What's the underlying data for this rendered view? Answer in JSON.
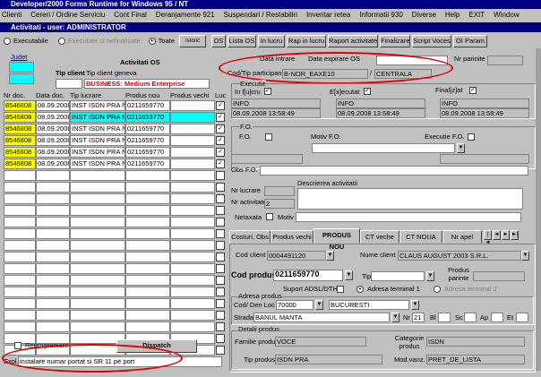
{
  "window": {
    "title": "Developer/2000 Forms Runtime for Windows 95 / NT"
  },
  "menu": [
    "Clienti",
    "Cereri / Ordine Serviciu",
    "Cont Final",
    "Deranjamente 921",
    "Suspendari / Restabiliri",
    "Inventar retea",
    "Informatii 930",
    "Diverse",
    "Help",
    "EXIT",
    "Window"
  ],
  "form_title": "Activitati - user: ADMINISTRATOR",
  "filters": {
    "executabile": "Executabile",
    "executate": "Executate si nefinalizate",
    "toate": "Toate"
  },
  "toolbar": [
    "Istoric",
    "OS",
    "Lista OS",
    "In lucru",
    "Rap in lucru",
    "Raport activitate",
    "Finalizare",
    "Script Voces",
    "OI Param"
  ],
  "judet_label": "Judet",
  "activitati_os": "Activitati OS",
  "tip_client_label": "Tip client",
  "tip_client_value": "Tip client geneva",
  "business": "BUSINESS: Medium Enterprise",
  "data_intrare_label": "Data intrare",
  "data_expirare_label": "Data expirare OS",
  "nr_pariuri_label": "Nr parinite",
  "cod_tip_label": "Cod/Tip participant",
  "cod_value": "B-NOR_EAXE10",
  "centrala": "CENTRALA",
  "executie_label": "Executie",
  "in_lucru_label": "In l[u]cru",
  "executat_label": "E[x]ecutat",
  "finalizat_label": "Final[z]at",
  "info": "INFO",
  "info_date": "08.09.2008 13:58:49",
  "fo_label": "F.O.",
  "motiv_fo_label": "Motiv F.O.",
  "executie_fo_label": "Executie F.O.",
  "obs_fo_label": "Obs F.O.",
  "nr_lucrare_label": "Nr lucrare",
  "nr_activitate_label": "Nr activitate",
  "nr_activitate_value": "2",
  "descriere_label": "Descrierea activitatii",
  "netaxata_label": "Netaxata",
  "motiv_label": "Motiv",
  "grid_headers": [
    "Nr doc.",
    "Data doc.",
    "Tip lucrare",
    "Produs nou",
    "Produs vechi",
    "Luc"
  ],
  "grid_rows": [
    {
      "nr": "8546808",
      "data": "08.09.2008",
      "tip": "INST ISDN PRA NP",
      "nou": "0211659770",
      "vechi": ""
    },
    {
      "nr": "8546808",
      "data": "08.09.2008",
      "tip": "INST ISDN PRA NP",
      "nou": "0211659770",
      "vechi": ""
    },
    {
      "nr": "8546808",
      "data": "08.09.2008",
      "tip": "INST ISDN PRA NP",
      "nou": "0211659770",
      "vechi": ""
    },
    {
      "nr": "8546808",
      "data": "08.09.2008",
      "tip": "INST ISDN PRA NP",
      "nou": "0211659770",
      "vechi": ""
    },
    {
      "nr": "8546808",
      "data": "08.09.2008",
      "tip": "INST ISDN PRA NP",
      "nou": "0211659770",
      "vechi": ""
    },
    {
      "nr": "8546808",
      "data": "08.09.2008",
      "tip": "INST ISDN PRA NP",
      "nou": "0211659770",
      "vechi": ""
    }
  ],
  "tabs": [
    "Costuri, Obs",
    "Produs vechi",
    "PRODUS NOU",
    "CT veche",
    "CT NOUA",
    "Nr apel"
  ],
  "cod_client_label": "Cod client",
  "cod_client": "0004491120",
  "nume_client_label": "Nume client",
  "nume_client": "CLAUS AUGUST 2003 S.R.L.",
  "cod_produs_label": "Cod produs",
  "cod_produs": "0211659770",
  "tip_label": "Tip",
  "produs_parinte_label": "Produs parinte",
  "suport_label": "Suport ADSL/DTH",
  "adresa1": "Adresa terminal 1",
  "adresa2": "Adresa terminal 2",
  "adresa_produs_label": "Adresa produs",
  "cod_den_loc_label": "Cod/ Den Loc",
  "cod_loc": "70000",
  "den_loc": "BUCURESTI",
  "strada_label": "Strada",
  "strada": "BANUL MANTA",
  "nr_label": "Nr",
  "nr": "21",
  "bl_label": "Bl",
  "sc_label": "Sc",
  "ap_label": "Ap",
  "et_label": "Et",
  "detalii_label": "Detalii produs",
  "familie_label": "Familie produs",
  "familie": "VOCE",
  "categorie_label": "Categorie produs",
  "categorie": "ISDN",
  "tip_produs_label": "Tip produs",
  "tip_produs": "ISDN PRA",
  "mod_vanz_label": "Mod.vanz.",
  "mod_vanz": "PRET_DE_LISTA",
  "reprogramare": "Reprogramare",
  "dispatch": "Dispatch",
  "expl_label": "Expl.",
  "expl": "instalare numar portat si SR 11 pe port"
}
